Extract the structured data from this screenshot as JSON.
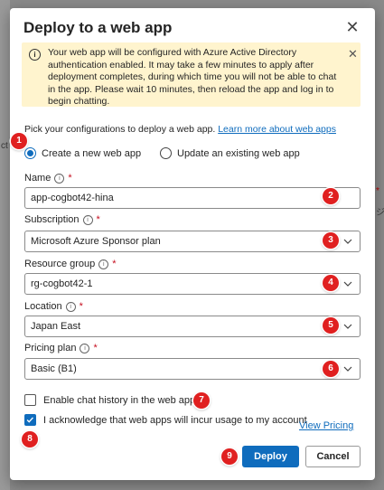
{
  "background": {
    "side_texts": [
      "ct",
      "*",
      "ジ"
    ]
  },
  "dialog": {
    "title": "Deploy to a web app",
    "close_icon": "close-icon"
  },
  "banner": {
    "icon": "info-icon",
    "text": "Your web app will be configured with Azure Active Directory authentication enabled. It may take a few minutes to apply after deployment completes, during which time you will not be able to chat in the app. Please wait 10 minutes, then reload the app and log in to begin chatting.",
    "close_icon": "close-icon"
  },
  "intro": {
    "text": "Pick your configurations to deploy a web app.",
    "link": "Learn more about web apps"
  },
  "mode": {
    "options": [
      "Create a new web app",
      "Update an existing web app"
    ],
    "selected": "Create a new web app"
  },
  "fields": {
    "name": {
      "label": "Name",
      "required": "*",
      "value": "app-cogbot42-hina"
    },
    "subscription": {
      "label": "Subscription",
      "required": "*",
      "value": "Microsoft Azure Sponsor plan"
    },
    "resource_group": {
      "label": "Resource group",
      "required": "*",
      "value": "rg-cogbot42-1"
    },
    "location": {
      "label": "Location",
      "required": "*",
      "value": "Japan East"
    },
    "pricing_plan": {
      "label": "Pricing plan",
      "required": "*",
      "value": "Basic (B1)"
    }
  },
  "checkboxes": {
    "chat_history": {
      "label": "Enable chat history in the web app",
      "checked": false
    },
    "acknowledge": {
      "label": "I acknowledge that web apps will incur usage to my account",
      "checked": true
    }
  },
  "view_pricing": "View Pricing",
  "buttons": {
    "deploy": "Deploy",
    "cancel": "Cancel"
  },
  "markers": [
    "1",
    "2",
    "3",
    "4",
    "5",
    "6",
    "7",
    "8",
    "9"
  ],
  "colors": {
    "accent": "#0f6cbd",
    "banner_bg": "#fff4ce",
    "marker": "#e02020",
    "required": "#c50f1f"
  }
}
